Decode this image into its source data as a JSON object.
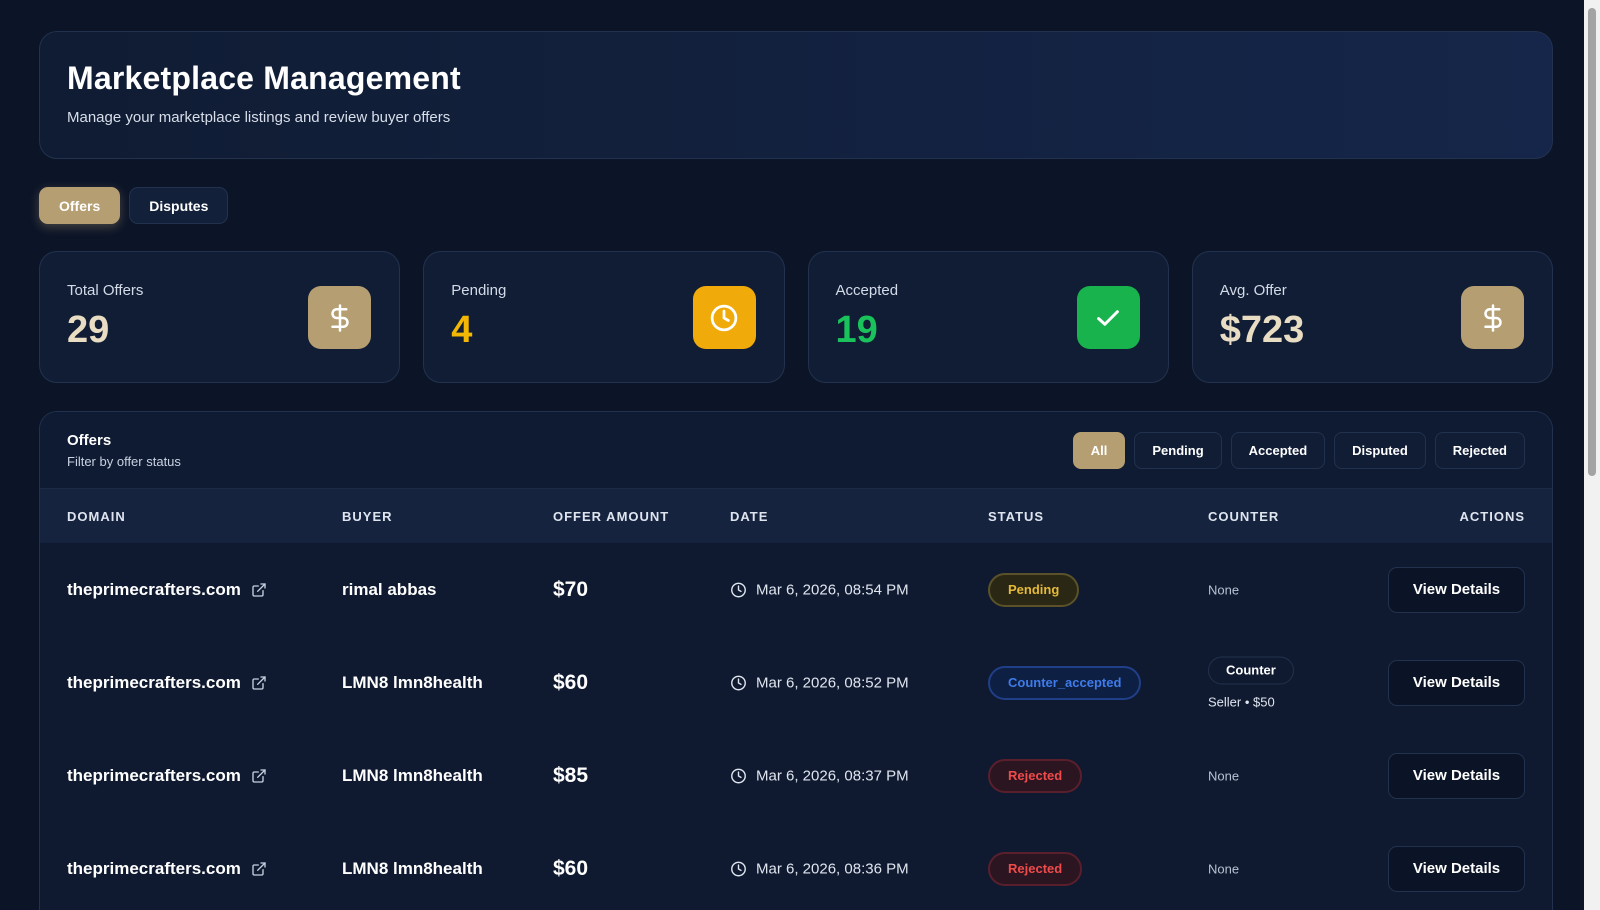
{
  "header": {
    "title": "Marketplace Management",
    "subtitle": "Manage your marketplace listings and review buyer offers"
  },
  "tabs": [
    {
      "label": "Offers",
      "active": true
    },
    {
      "label": "Disputes",
      "active": false
    }
  ],
  "stats": [
    {
      "label": "Total Offers",
      "value": "29",
      "icon": "dollar-icon",
      "value_color": "#e8dcc2",
      "icon_bg": "#b59f72"
    },
    {
      "label": "Pending",
      "value": "4",
      "icon": "clock-icon",
      "value_color": "#f2b705",
      "icon_bg": "#f0aa0a"
    },
    {
      "label": "Accepted",
      "value": "19",
      "icon": "check-icon",
      "value_color": "#19c25a",
      "icon_bg": "#19b34e"
    },
    {
      "label": "Avg. Offer",
      "value": "$723",
      "icon": "dollar-icon",
      "value_color": "#e8dcc2",
      "icon_bg": "#b59f72"
    }
  ],
  "offers": {
    "title": "Offers",
    "subtitle": "Filter by offer status",
    "filters": [
      "All",
      "Pending",
      "Accepted",
      "Disputed",
      "Rejected"
    ],
    "active_filter": "All",
    "columns": [
      "DOMAIN",
      "BUYER",
      "OFFER AMOUNT",
      "DATE",
      "STATUS",
      "COUNTER",
      "ACTIONS"
    ],
    "rows": [
      {
        "domain": "theprimecrafters.com",
        "buyer": "rimal abbas",
        "amount": "$70",
        "date": "Mar 6, 2026, 08:54 PM",
        "status": "Pending",
        "status_type": "pending",
        "counter": "None",
        "counter_label": "",
        "counter_meta": "",
        "action": "View Details"
      },
      {
        "domain": "theprimecrafters.com",
        "buyer": "LMN8 lmn8health",
        "amount": "$60",
        "date": "Mar 6, 2026, 08:52 PM",
        "status": "Counter_accepted",
        "status_type": "counter",
        "counter": "",
        "counter_label": "Counter",
        "counter_meta": "Seller • $50",
        "action": "View Details"
      },
      {
        "domain": "theprimecrafters.com",
        "buyer": "LMN8 lmn8health",
        "amount": "$85",
        "date": "Mar 6, 2026, 08:37 PM",
        "status": "Rejected",
        "status_type": "rejected",
        "counter": "None",
        "counter_label": "",
        "counter_meta": "",
        "action": "View Details"
      },
      {
        "domain": "theprimecrafters.com",
        "buyer": "LMN8 lmn8health",
        "amount": "$60",
        "date": "Mar 6, 2026, 08:36 PM",
        "status": "Rejected",
        "status_type": "rejected",
        "counter": "None",
        "counter_label": "",
        "counter_meta": "",
        "action": "View Details"
      }
    ]
  }
}
